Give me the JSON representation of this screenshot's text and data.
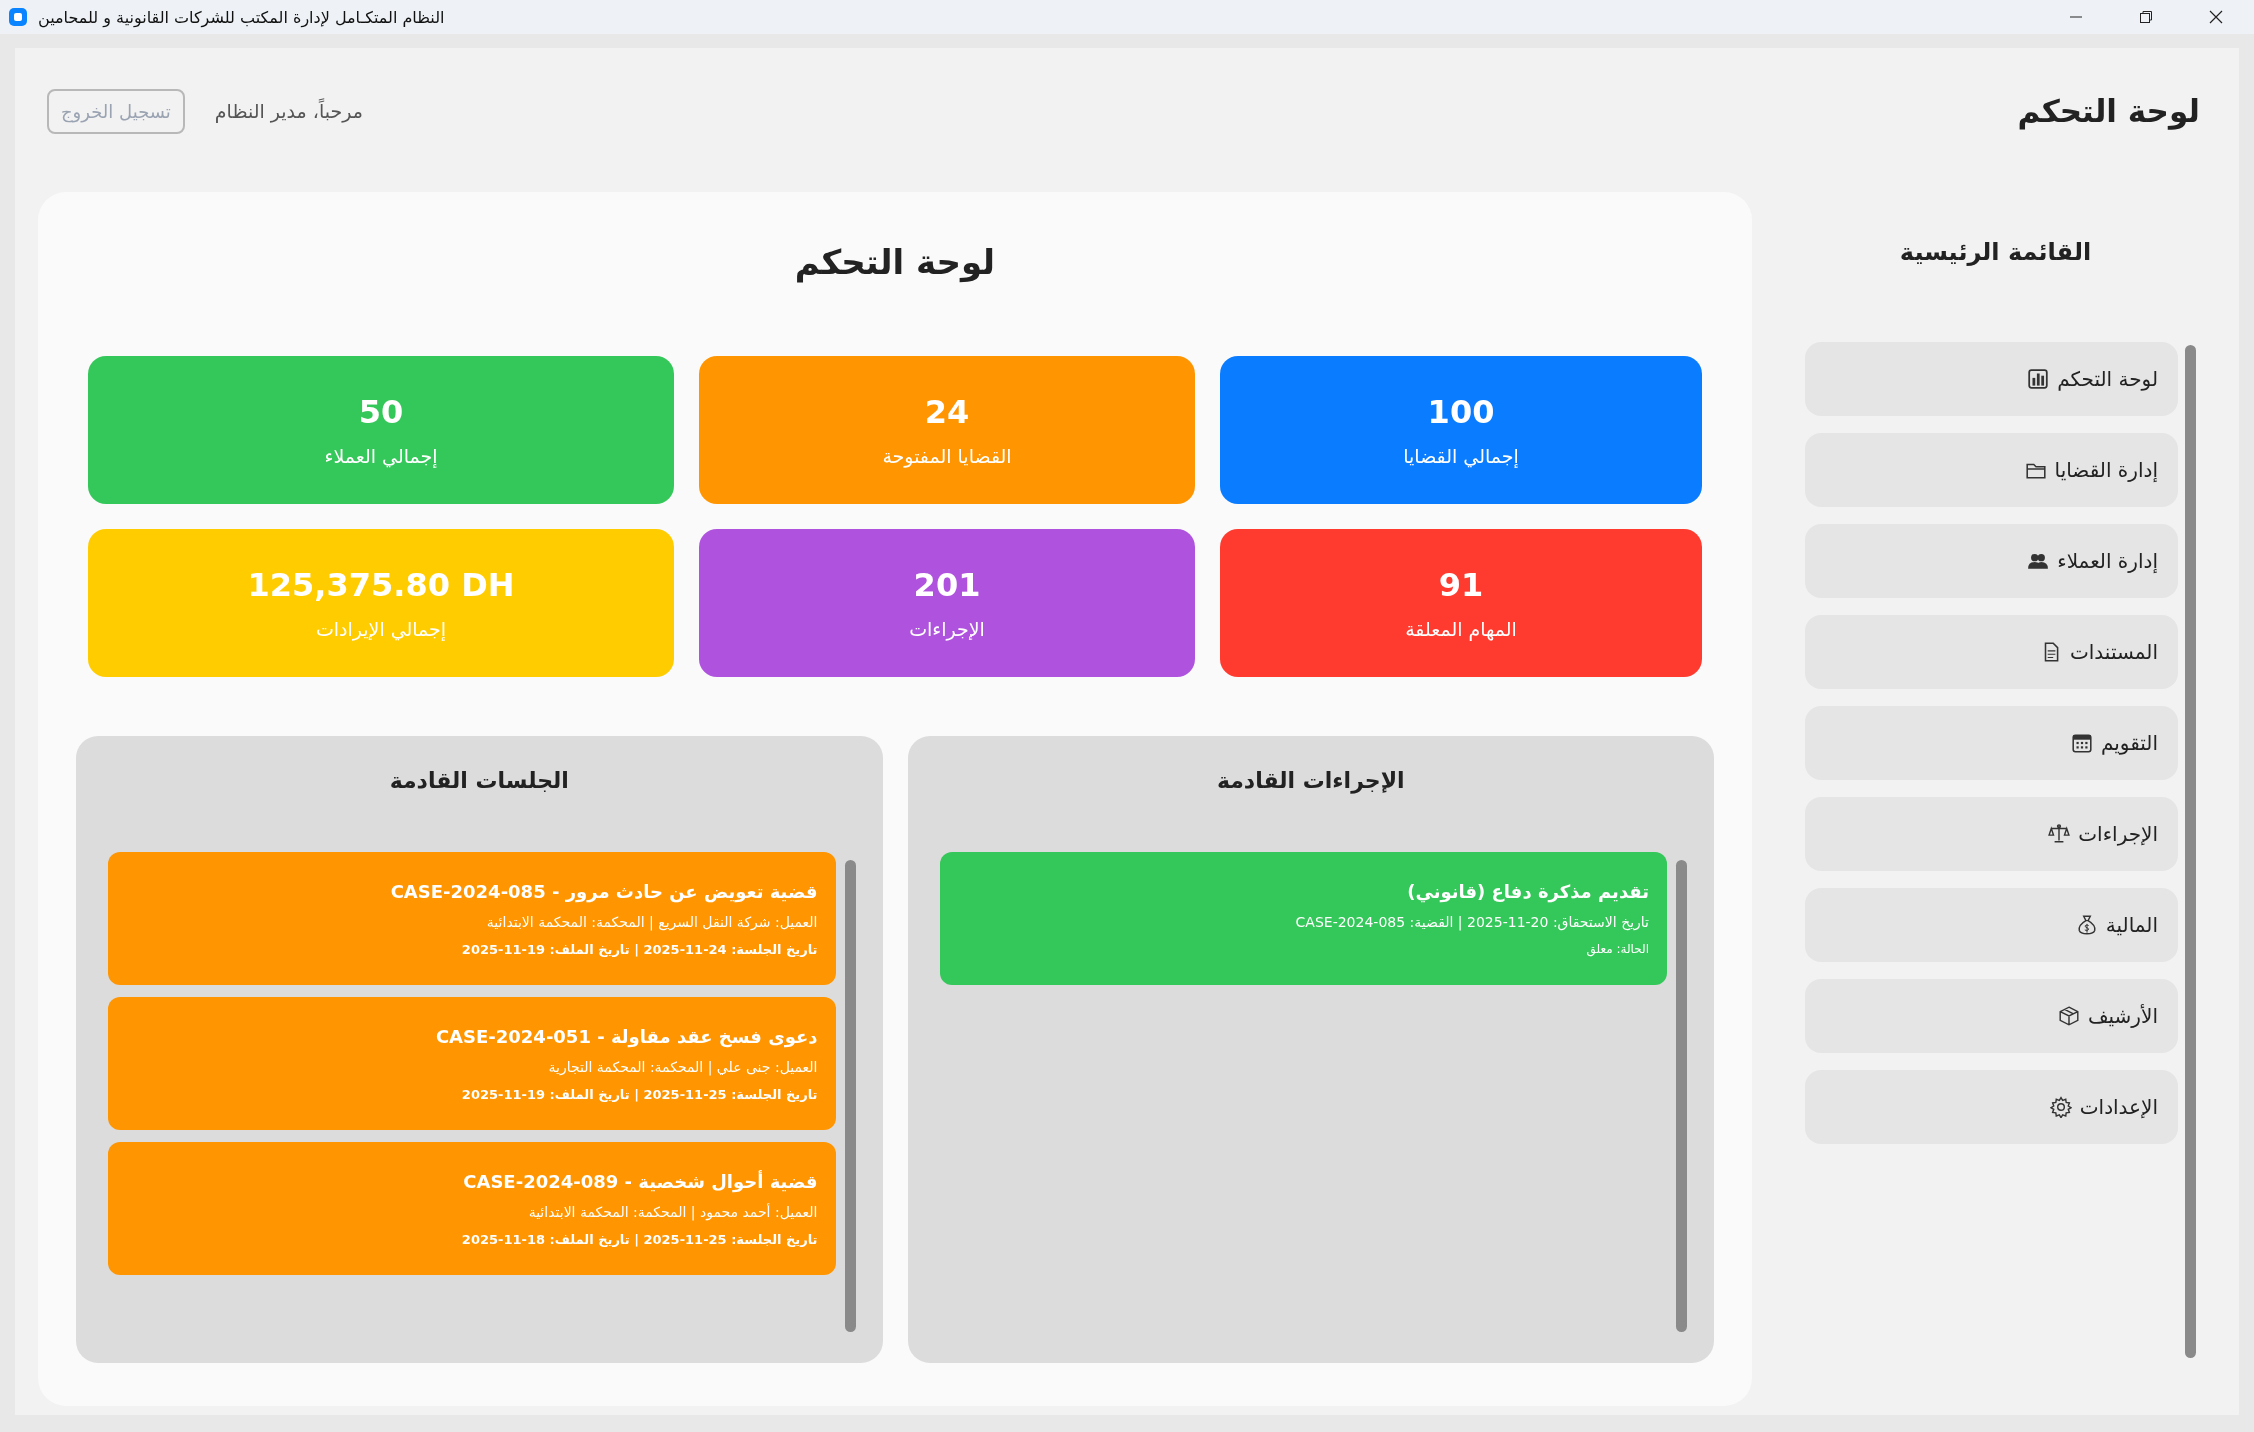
{
  "window": {
    "title": "النظام المتكـامل لإدارة المكتب للشركات القانونية و للمحامين"
  },
  "header": {
    "title": "لوحة التحكم",
    "welcome": "مرحباً، مدير النظام",
    "logout": {
      "label": "تسجيل الخروج",
      "disabled": true
    }
  },
  "sidebar": {
    "title": "القائمة الرئيسية",
    "items": [
      {
        "label": "لوحة التحكم"
      },
      {
        "label": "إدارة القضايا"
      },
      {
        "label": "إدارة العملاء"
      },
      {
        "label": "المستندات"
      },
      {
        "label": "التقويم"
      },
      {
        "label": "الإجراءات"
      },
      {
        "label": "المالية"
      },
      {
        "label": "الأرشيف"
      },
      {
        "label": "الإعدادات"
      }
    ]
  },
  "dashboard": {
    "title": "لوحة التحكم",
    "stats": [
      {
        "value": "100",
        "label": "إجمالي القضايا",
        "color": "#0a7cff"
      },
      {
        "value": "24",
        "label": "القضايا المفتوحة",
        "color": "#ff9500"
      },
      {
        "value": "50",
        "label": "إجمالي العملاء",
        "color": "#34c759"
      },
      {
        "value": "91",
        "label": "المهام المعلقة",
        "color": "#ff3b30"
      },
      {
        "value": "201",
        "label": "الإجراءات",
        "color": "#af52de"
      },
      {
        "value": "125,375.80 DH",
        "label": "إجمالي الإيرادات",
        "color": "#ffcc00"
      }
    ]
  },
  "upcoming_procedures": {
    "title": "الإجراءات القادمة",
    "items": [
      {
        "title": "تقديم مذكرة دفاع (قانوني)",
        "details": "تاريخ الاستحقاق: 20-11-2025 | القضية: CASE-2024-085",
        "status": "الحالة: معلق",
        "color": "#34c759"
      }
    ]
  },
  "upcoming_sessions": {
    "title": "الجلسات القادمة",
    "items": [
      {
        "title": "قضية تعويض عن حادث مرور - CASE-2024-085",
        "details": "العميل: شركة النقل السريع | المحكمة: المحكمة الابتدائية",
        "dates": "تاريخ الجلسة: 24-11-2025 | تاريخ الملف: 19-11-2025",
        "color": "#ff9500"
      },
      {
        "title": "دعوى فسخ عقد مقاولة - CASE-2024-051",
        "details": "العميل: جنى علي | المحكمة: المحكمة التجارية",
        "dates": "تاريخ الجلسة: 25-11-2025 | تاريخ الملف: 19-11-2025",
        "color": "#ff9500"
      },
      {
        "title": "قضية أحوال شخصية - CASE-2024-089",
        "details": "العميل: أحمد محمود | المحكمة: المحكمة الابتدائية",
        "dates": "تاريخ الجلسة: 25-11-2025 | تاريخ الملف: 18-11-2025",
        "color": "#ff9500"
      }
    ]
  }
}
